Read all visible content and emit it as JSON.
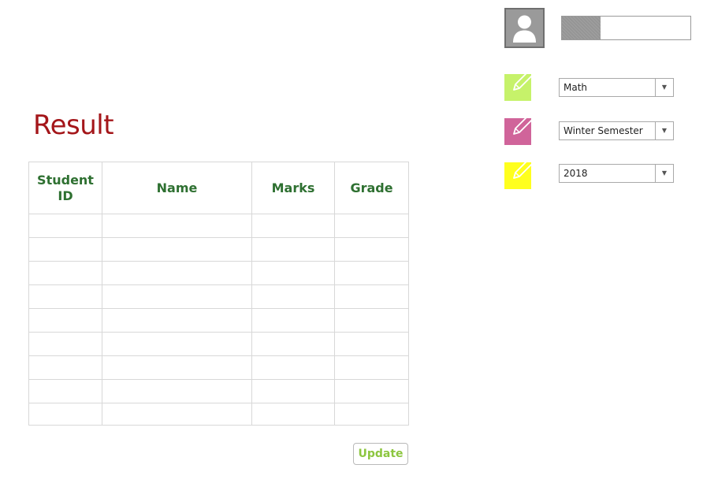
{
  "page": {
    "title": "Result"
  },
  "table": {
    "columns": [
      "Student ID",
      "Name",
      "Marks",
      "Grade"
    ],
    "rows": [
      [
        "",
        "",
        "",
        ""
      ],
      [
        "",
        "",
        "",
        ""
      ],
      [
        "",
        "",
        "",
        ""
      ],
      [
        "",
        "",
        "",
        ""
      ],
      [
        "",
        "",
        "",
        ""
      ],
      [
        "",
        "",
        "",
        ""
      ],
      [
        "",
        "",
        "",
        ""
      ],
      [
        "",
        "",
        "",
        ""
      ],
      [
        "",
        "",
        "",
        ""
      ]
    ]
  },
  "update_button": {
    "label": "Update"
  },
  "profile": {
    "avatar_icon": "user-silhouette-icon",
    "progress_fraction": 0.3
  },
  "filters": [
    {
      "icon": "pencil-note-icon",
      "icon_color": "#c6f26a",
      "value": "Math"
    },
    {
      "icon": "pencil-note-icon",
      "icon_color": "#d0649a",
      "value": "Winter Semester"
    },
    {
      "icon": "pencil-note-icon",
      "icon_color": "#ffff1e",
      "value": "2018"
    }
  ],
  "colors": {
    "title": "#a4161a",
    "header_text": "#2e7031",
    "button_text": "#8cc63f",
    "avatar_bg": "#9a9a9a",
    "progress_fill": "#959595"
  }
}
